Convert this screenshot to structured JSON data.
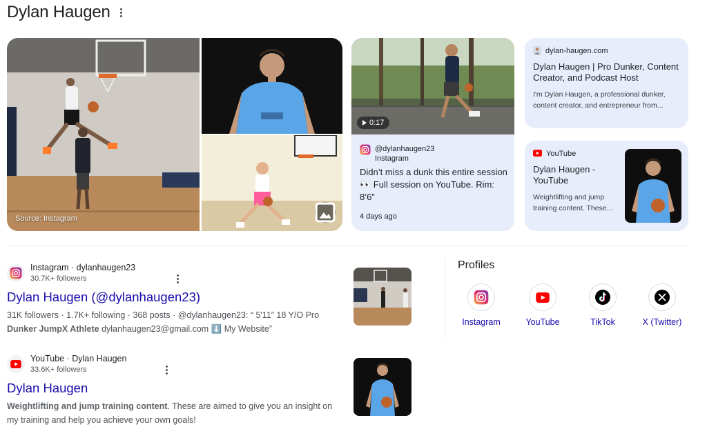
{
  "header": {
    "title": "Dylan Haugen"
  },
  "media": {
    "source_label": "Source: Instagram"
  },
  "instagram_post": {
    "duration": "0:17",
    "handle": "@dylanhaugen23",
    "platform": "Instagram",
    "text": "Didn’t miss a dunk this entire session 👀 Full session on YouTube. Rim: 8’6”",
    "date": "4 days ago"
  },
  "website_card": {
    "domain": "dylan-haugen.com",
    "title": "Dylan Haugen | Pro Dunker, Content Creator, and Podcast Host",
    "snippet": "I'm Dylan Haugen, a professional dunker, content creator, and entrepreneur from..."
  },
  "youtube_card": {
    "source": "YouTube",
    "title": "Dylan Haugen - YouTube",
    "snippet": "Weightlifting and jump training content. These..."
  },
  "results": [
    {
      "site": "Instagram · dylanhaugen23",
      "followers": "30.7K+ followers",
      "title": "Dylan Haugen (@dylanhaugen23)",
      "snippet_plain": "31K followers · 1.7K+ following · 368 posts · @dylanhaugen23: “ 5'11” 18 Y/O Pro ",
      "snippet_bold": "Dunker JumpX Athlete",
      "snippet_tail": " dylanhaugen23@gmail.com ⬇️ My Website”"
    },
    {
      "site": "YouTube · Dylan Haugen",
      "followers": "33.6K+ followers",
      "title": "Dylan Haugen",
      "snippet_bold": "Weightlifting and jump training content",
      "snippet_tail": ". These are aimed to give you an insight on my training and help you achieve your own goals!"
    }
  ],
  "profiles": {
    "title": "Profiles",
    "items": [
      {
        "label": "Instagram",
        "icon": "instagram-icon"
      },
      {
        "label": "YouTube",
        "icon": "youtube-icon"
      },
      {
        "label": "TikTok",
        "icon": "tiktok-icon"
      },
      {
        "label": "X (Twitter)",
        "icon": "x-icon"
      }
    ]
  },
  "colors": {
    "link": "#1a0dab",
    "card_bg": "#e8edfb",
    "jersey": "#4a8fd6",
    "youtube_red": "#ff0000"
  }
}
